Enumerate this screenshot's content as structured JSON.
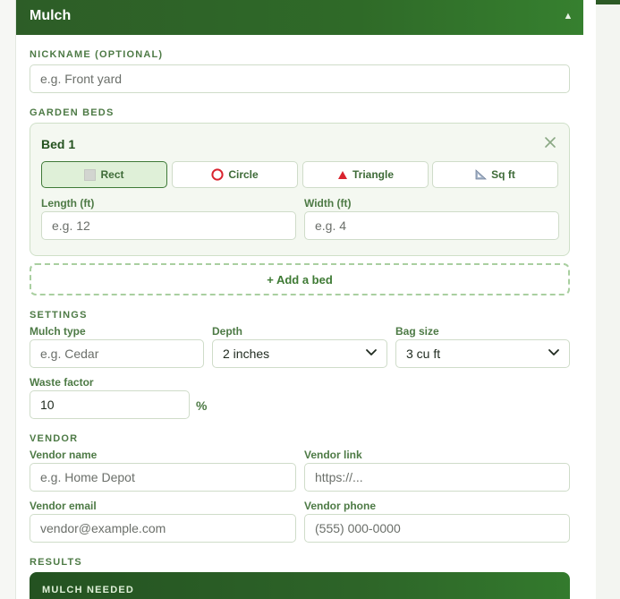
{
  "card": {
    "title": "Mulch",
    "collapse_icon": "▲"
  },
  "nickname": {
    "label": "NICKNAME (OPTIONAL)",
    "placeholder": "e.g. Front yard"
  },
  "garden_beds": {
    "label": "GARDEN BEDS",
    "beds": [
      {
        "title": "Bed 1",
        "shapes": [
          {
            "label": "Rect",
            "icon": "rectangle-icon",
            "active": true
          },
          {
            "label": "Circle",
            "icon": "circle-icon",
            "active": false
          },
          {
            "label": "Triangle",
            "icon": "triangle-icon",
            "active": false
          },
          {
            "label": "Sq ft",
            "icon": "ruler-icon",
            "active": false
          }
        ],
        "length_label": "Length (ft)",
        "length_placeholder": "e.g. 12",
        "width_label": "Width (ft)",
        "width_placeholder": "e.g. 4"
      }
    ],
    "add_bed_label": "+ Add a bed"
  },
  "settings": {
    "label": "SETTINGS",
    "mulch_type_label": "Mulch type",
    "mulch_type_placeholder": "e.g. Cedar",
    "depth_label": "Depth",
    "depth_value": "2 inches",
    "bag_size_label": "Bag size",
    "bag_size_value": "3 cu ft",
    "waste_factor_label": "Waste factor",
    "waste_factor_value": "10",
    "waste_factor_unit": "%"
  },
  "vendor": {
    "label": "VENDOR",
    "name_label": "Vendor name",
    "name_placeholder": "e.g. Home Depot",
    "link_label": "Vendor link",
    "link_placeholder": "https://...",
    "email_label": "Vendor email",
    "email_placeholder": "vendor@example.com",
    "phone_label": "Vendor phone",
    "phone_placeholder": "(555) 000-0000"
  },
  "results": {
    "label": "RESULTS",
    "mulch_needed_label": "MULCH NEEDED"
  },
  "colors": {
    "brand_green": "#2d5d27",
    "accent_green": "#3e7a34",
    "label_green": "#4d7a45",
    "triangle_red": "#d9232e",
    "circle_red": "#d9232e"
  }
}
